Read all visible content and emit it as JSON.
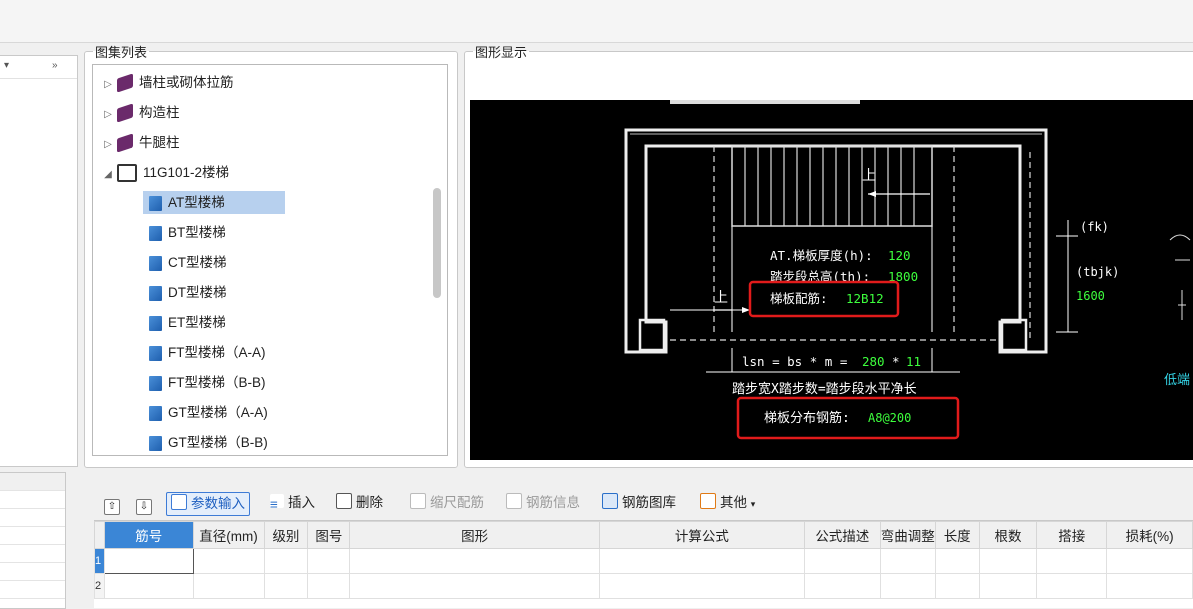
{
  "tree_panel": {
    "title": "图集列表",
    "items": [
      {
        "label": "墙柱或砌体拉筋",
        "arrow": "▷",
        "icon": "book-icon"
      },
      {
        "label": "构造柱",
        "arrow": "▷",
        "icon": "book-icon"
      },
      {
        "label": "牛腿柱",
        "arrow": "▷",
        "icon": "book-icon"
      },
      {
        "label": "11G101-2楼梯",
        "arrow": "◢",
        "icon": "open-book-icon"
      },
      {
        "label": "AT型楼梯",
        "icon": "document-icon",
        "selected": true
      },
      {
        "label": "BT型楼梯",
        "icon": "document-icon"
      },
      {
        "label": "CT型楼梯",
        "icon": "document-icon"
      },
      {
        "label": "DT型楼梯",
        "icon": "document-icon"
      },
      {
        "label": "ET型楼梯",
        "icon": "document-icon"
      },
      {
        "label": "FT型楼梯（A-A)",
        "icon": "document-icon"
      },
      {
        "label": "FT型楼梯（B-B)",
        "icon": "document-icon"
      },
      {
        "label": "GT型楼梯（A-A)",
        "icon": "document-icon"
      },
      {
        "label": "GT型楼梯（B-B)",
        "icon": "document-icon"
      }
    ]
  },
  "drawing_panel": {
    "title": "图形显示",
    "drawing": {
      "up_label": "上",
      "thickness_label": "AT.梯板厚度(h):",
      "thickness_value": "120",
      "height_label": "踏步段总高(th):",
      "height_value": "1800",
      "rebar_label": "梯板配筋:",
      "rebar_value": "12B12",
      "formula_text": "lsn = bs * m =",
      "formula_bs": "280",
      "formula_star": "*",
      "formula_m": "11",
      "formula_desc": "踏步宽X踏步数=踏步段水平净长",
      "dist_label": "梯板分布钢筋:",
      "dist_value": "A8@200",
      "fk": "(fk)",
      "tbjk": "(tbjk)",
      "tbjk_value": "1600",
      "low_end": "低端",
      "colors": {
        "white": "#ffffff",
        "green": "#3dff3d",
        "cyan": "#35d4e6",
        "red": "#e11b1b"
      }
    }
  },
  "toolbar": {
    "up": "up-arrow-icon",
    "down": "down-arrow-icon",
    "param_input": "参数输入",
    "insert": "插入",
    "delete": "删除",
    "scale_rebar": "缩尺配筋",
    "rebar_info": "钢筋信息",
    "rebar_library": "钢筋图库",
    "other": "其他"
  },
  "grid": {
    "columns": [
      "筋号",
      "直径(mm)",
      "级别",
      "图号",
      "图形",
      "计算公式",
      "公式描述",
      "弯曲调整",
      "长度",
      "根数",
      "搭接",
      "损耗(%)"
    ],
    "rows": [
      "1",
      "2"
    ]
  }
}
